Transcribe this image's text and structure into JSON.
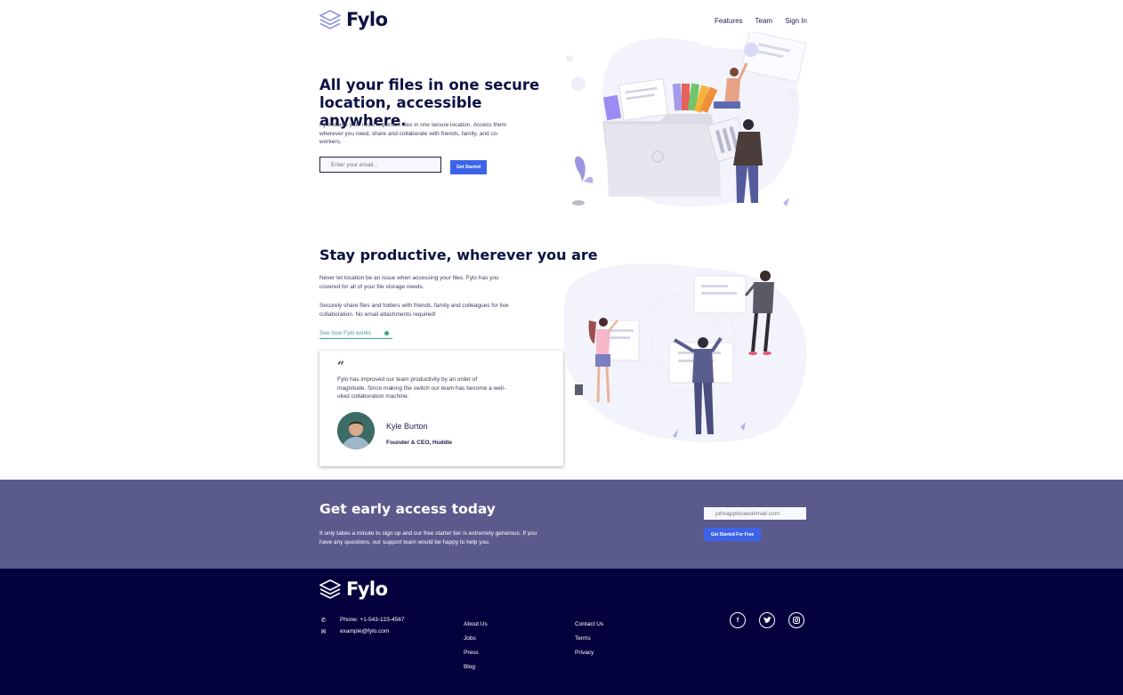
{
  "brand": {
    "name": "Fylo"
  },
  "nav": {
    "items": [
      "Features",
      "Team",
      "Sign In"
    ]
  },
  "hero": {
    "title": "All your files in one secure location, accessible anywhere.",
    "text": "Fylo stores your most important files in one secure location. Access them wherever you need, share and collaborate with friends, family, and co-workers.",
    "email_placeholder": "Enter your email...",
    "button_label": "Get Started"
  },
  "productive": {
    "title": "Stay productive, wherever you are",
    "p1": "Never let location be an issue when accessing your files. Fylo has you covered for all of your file storage needs.",
    "p2": "Securely share files and folders with friends, family and colleagues for live collaboration. No email attachments required!",
    "link_label": "See how Fylo works"
  },
  "testimonial": {
    "quote_mark": "“",
    "text": "Fylo has improved our team productivity by an order of magnitude. Since making the switch our team has become a well-oiled collaboration machine.",
    "name": "Kyle Burton",
    "role": "Founder & CEO, Huddle"
  },
  "early_access": {
    "title": "Get early access today",
    "text": "It only takes a minute to sign up and our free starter tier is extremely generous. If you have any questions, our support team would be happy to help you.",
    "email_placeholder": "johnappleseed#mail.com",
    "button_label": "Get Started For Free"
  },
  "footer": {
    "phone": "Phone: +1-543-123-4567",
    "email": "example@fylo.com",
    "col1": [
      "About Us",
      "Jobs",
      "Press",
      "Blog"
    ],
    "col2": [
      "Contact Us",
      "Terms",
      "Privacy"
    ],
    "socials": [
      "facebook-icon",
      "twitter-icon",
      "instagram-icon"
    ]
  },
  "colors": {
    "accent_blue": "#3d64e8",
    "teal_link": "#3ba58e",
    "early_bg": "#5b5a8c",
    "footer_bg": "#04023d",
    "heading": "#0c1142"
  }
}
